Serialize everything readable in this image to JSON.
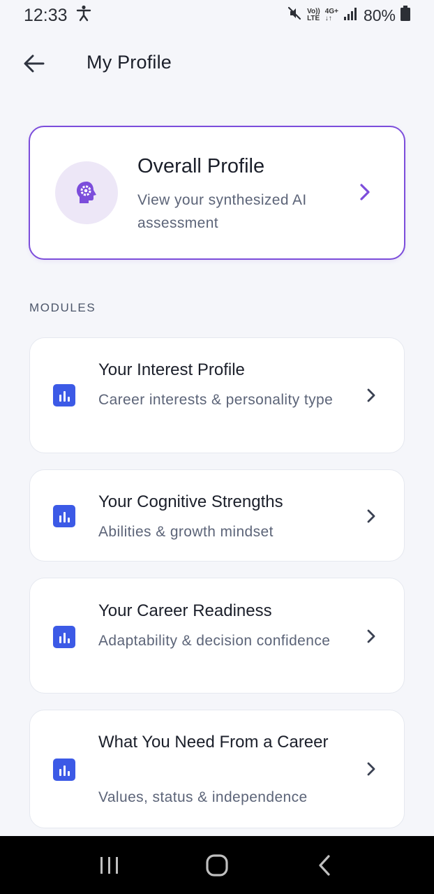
{
  "status_bar": {
    "time": "12:33",
    "volte_top": "Vo))",
    "volte_bottom": "LTE",
    "network_top": "4G+",
    "network_bottom": "↓↑",
    "battery": "80%"
  },
  "header": {
    "title": "My Profile"
  },
  "overall": {
    "title": "Overall Profile",
    "subtitle": "View your synthesized AI assessment"
  },
  "modules_label": "MODULES",
  "modules": [
    {
      "title": "Your Interest Profile",
      "subtitle": "Career interests & personality type"
    },
    {
      "title": "Your Cognitive Strengths",
      "subtitle": "Abilities & growth mindset"
    },
    {
      "title": "Your Career Readiness",
      "subtitle": "Adaptability & decision confidence"
    },
    {
      "title": "What You Need From a Career",
      "subtitle": "Values, status & independence"
    }
  ],
  "colors": {
    "accent_purple": "#7c4ddb",
    "module_blue": "#3c5ae6",
    "background": "#f5f6fa"
  }
}
